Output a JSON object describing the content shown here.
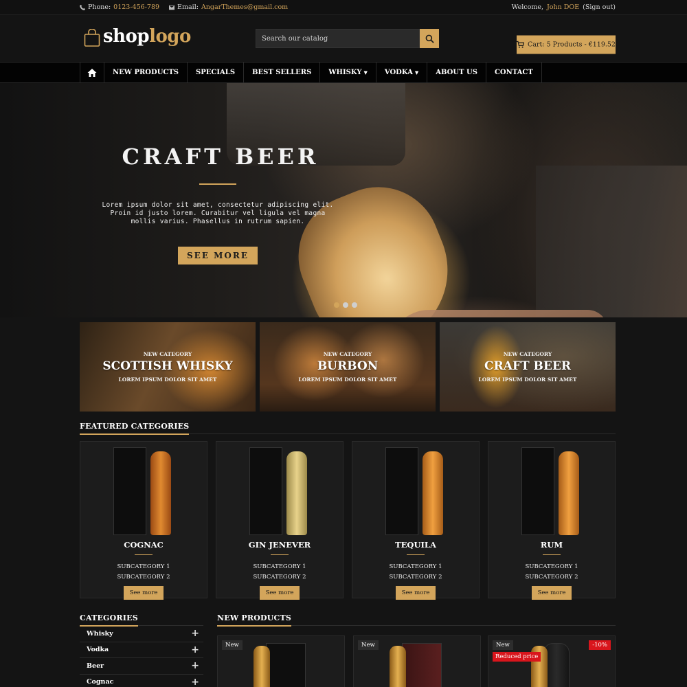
{
  "topbar": {
    "phone_label": "Phone:",
    "phone_value": "0123-456-789",
    "email_label": "Email:",
    "email_value": "AngarThemes@gmail.com",
    "welcome": "Welcome,",
    "user": "John DOE",
    "signout": "(Sign out)"
  },
  "header": {
    "logo_shop": "shop",
    "logo_logo": "logo",
    "search_placeholder": "Search our catalog",
    "cart_label": "Cart: 5 Products - €119.52"
  },
  "nav": {
    "items": [
      {
        "label": "NEW PRODUCTS"
      },
      {
        "label": "SPECIALS"
      },
      {
        "label": "BEST SELLERS"
      },
      {
        "label": "WHISKY",
        "dropdown": true
      },
      {
        "label": "VODKA",
        "dropdown": true
      },
      {
        "label": "ABOUT US"
      },
      {
        "label": "CONTACT"
      }
    ]
  },
  "hero": {
    "title": "CRAFT BEER",
    "text": "Lorem ipsum dolor sit amet, consectetur adipiscing elit. Proin id justo lorem. Curabitur vel ligula vel magna mollis varius. Phasellus in rutrum sapien.",
    "button": "SEE MORE",
    "slides": 3,
    "active_slide": 1
  },
  "banners": [
    {
      "tag": "NEW CATEGORY",
      "name": "SCOTTISH WHISKY",
      "sub": "LOREM IPSUM DOLOR SIT AMET"
    },
    {
      "tag": "NEW CATEGORY",
      "name": "BURBON",
      "sub": "LOREM IPSUM DOLOR SIT AMET"
    },
    {
      "tag": "NEW CATEGORY",
      "name": "CRAFT BEER",
      "sub": "LOREM IPSUM DOLOR SIT AMET"
    }
  ],
  "featured": {
    "title": "FEATURED CATEGORIES",
    "cards": [
      {
        "name": "COGNAC",
        "sub1": "SUBCATEGORY 1",
        "sub2": "SUBCATEGORY 2",
        "button": "See more"
      },
      {
        "name": "GIN JENEVER",
        "sub1": "SUBCATEGORY 1",
        "sub2": "SUBCATEGORY 2",
        "button": "See more"
      },
      {
        "name": "TEQUILA",
        "sub1": "SUBCATEGORY 1",
        "sub2": "SUBCATEGORY 2",
        "button": "See more"
      },
      {
        "name": "RUM",
        "sub1": "SUBCATEGORY 1",
        "sub2": "SUBCATEGORY 2",
        "button": "See more"
      }
    ]
  },
  "sidebar": {
    "title": "CATEGORIES",
    "items": [
      {
        "label": "Whisky",
        "icon": "plus-icon"
      },
      {
        "label": "Vodka",
        "icon": "plus-icon"
      },
      {
        "label": "Beer",
        "icon": "plus-icon"
      },
      {
        "label": "Cognac",
        "icon": "plus-icon"
      }
    ]
  },
  "new_products": {
    "title": "NEW PRODUCTS",
    "items": [
      {
        "badge": "New"
      },
      {
        "badge": "New"
      },
      {
        "badge": "New",
        "flag": "Reduced price",
        "discount": "-10%"
      }
    ]
  },
  "colors": {
    "accent": "#d3a55b",
    "background": "#141414",
    "sale": "#d9151c"
  }
}
